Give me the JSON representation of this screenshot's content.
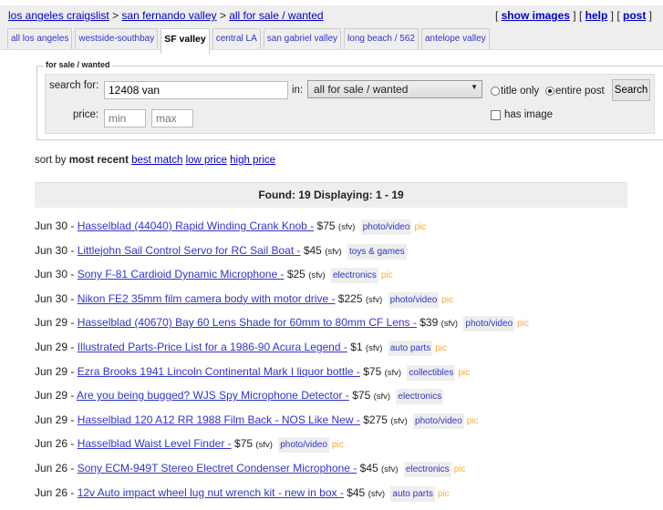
{
  "breadcrumb": [
    "los angeles craigslist",
    "san fernando valley",
    "all for sale / wanted"
  ],
  "sep": ">",
  "top_links": [
    "show images",
    "help",
    "post"
  ],
  "tabs": [
    "all los angeles",
    "westside-southbay",
    "SF valley",
    "central LA",
    "san gabriel valley",
    "long beach / 562",
    "antelope valley"
  ],
  "form": {
    "legend": "for sale / wanted",
    "search_label": "search for:",
    "query": "12408 van",
    "in_label": "in:",
    "category": "all for sale / wanted",
    "title_only": "title only",
    "entire_post": "entire post",
    "search_button": "Search",
    "price_label": "price:",
    "min_placeholder": "min",
    "max_placeholder": "max",
    "has_image": "has image"
  },
  "sort": {
    "label": "sort by",
    "current": "most recent",
    "options": [
      "best match",
      "low price",
      "high price"
    ]
  },
  "found": "Found: 19 Displaying: 1 - 19",
  "listings": [
    {
      "date": "Jun 30",
      "title": "Hasselblad (44040) Rapid Winding Crank Knob -",
      "price": "$75",
      "loc": "(sfv)",
      "cat": "photo/video",
      "pic": "pic"
    },
    {
      "date": "Jun 30",
      "title": "Littlejohn Sail Control Servo for RC Sail Boat -",
      "price": "$45",
      "loc": "(sfv)",
      "cat": "toys & games",
      "pic": ""
    },
    {
      "date": "Jun 30",
      "title": "Sony F-81 Cardioid Dynamic Microphone -",
      "price": "$25",
      "loc": "(sfv)",
      "cat": "electronics",
      "pic": "pic"
    },
    {
      "date": "Jun 30",
      "title": "Nikon FE2 35mm film camera body with motor drive -",
      "price": "$225",
      "loc": "(sfv)",
      "cat": "photo/video",
      "pic": "pic"
    },
    {
      "date": "Jun 29",
      "title": "Hasselblad (40670) Bay 60 Lens Shade for 60mm to 80mm CF Lens -",
      "price": "$39",
      "loc": "(sfv)",
      "cat": "photo/video",
      "pic": "pic"
    },
    {
      "date": "Jun 29",
      "title": "Illustrated Parts-Price List for a 1986-90 Acura Legend -",
      "price": "$1",
      "loc": "(sfv)",
      "cat": "auto parts",
      "pic": "pic"
    },
    {
      "date": "Jun 29",
      "title": "Ezra Brooks 1941 Lincoln Continental Mark I liquor bottle -",
      "price": "$75",
      "loc": "(sfv)",
      "cat": "collectibles",
      "pic": "pic"
    },
    {
      "date": "Jun 29",
      "title": "Are you being bugged? WJS Spy Microphone Detector -",
      "price": "$75",
      "loc": "(sfv)",
      "cat": "electronics",
      "pic": ""
    },
    {
      "date": "Jun 29",
      "title": "Hasselblad 120 A12 RR 1988 Film Back - NOS Like New -",
      "price": "$275",
      "loc": "(sfv)",
      "cat": "photo/video",
      "pic": "pic"
    },
    {
      "date": "Jun 26",
      "title": "Hasselblad Waist Level Finder -",
      "price": "$75",
      "loc": "(sfv)",
      "cat": "photo/video",
      "pic": "pic"
    },
    {
      "date": "Jun 26",
      "title": "Sony ECM-949T Stereo Electret Condenser Microphone -",
      "price": "$45",
      "loc": "(sfv)",
      "cat": "electronics",
      "pic": "pic"
    },
    {
      "date": "Jun 26",
      "title": "12v Auto impact wheel lug nut wrench kit - new in box -",
      "price": "$45",
      "loc": "(sfv)",
      "cat": "auto parts",
      "pic": "pic"
    }
  ]
}
